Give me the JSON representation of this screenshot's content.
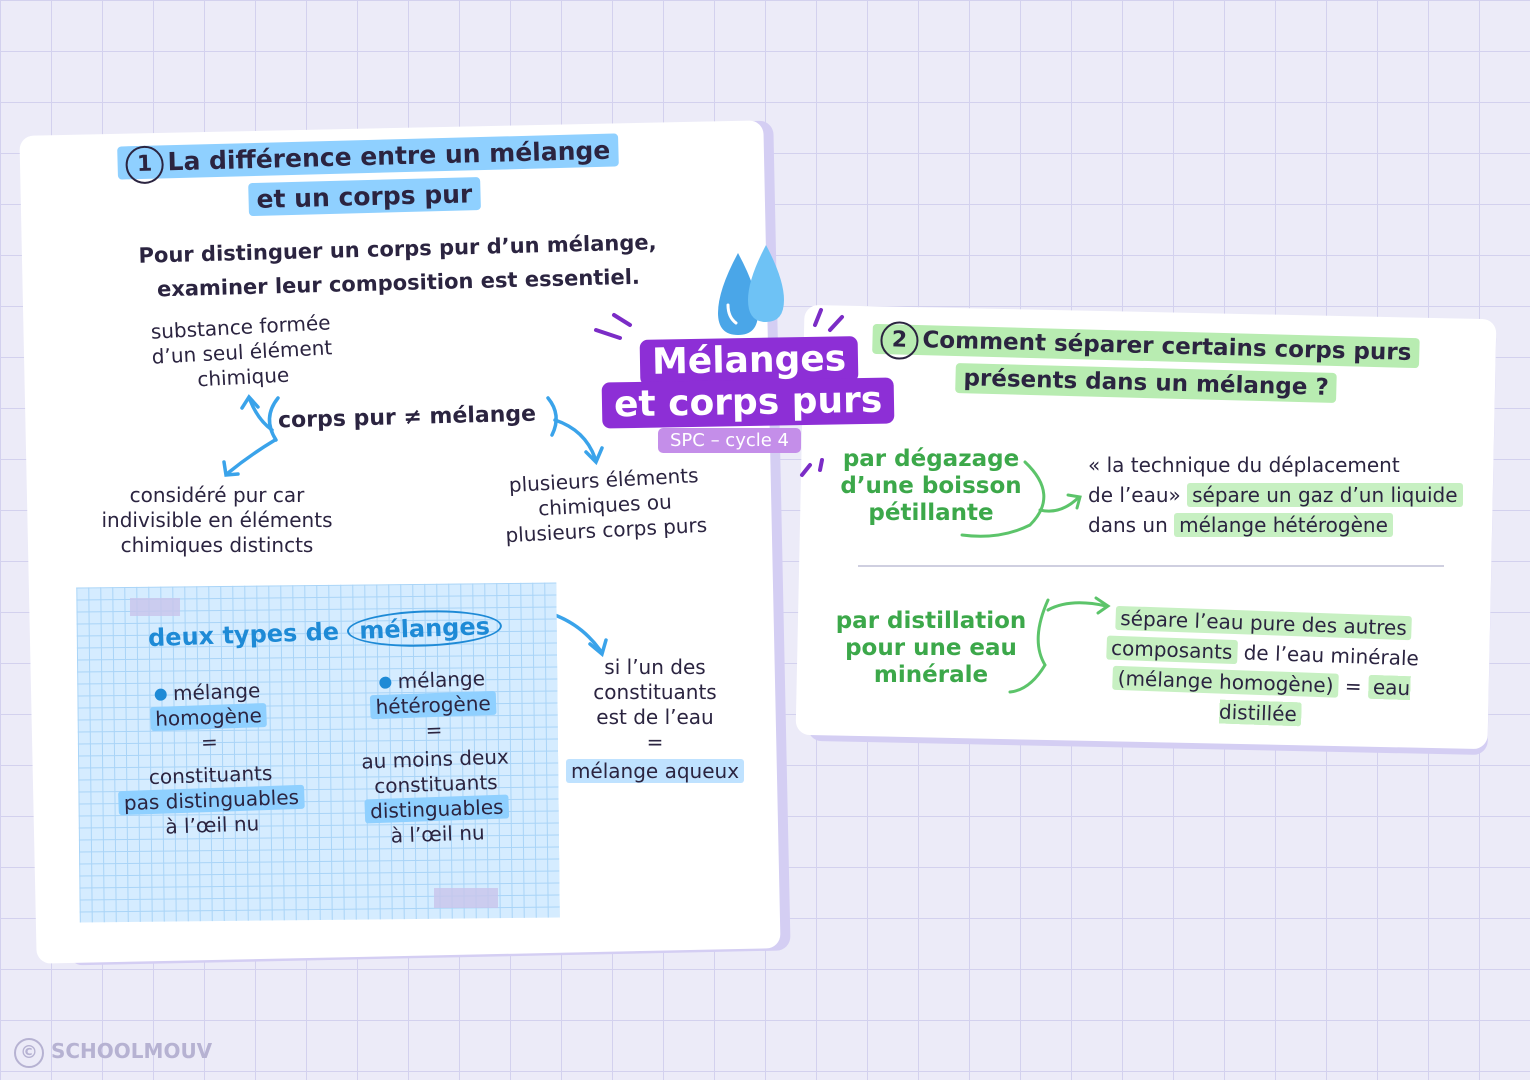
{
  "main_title": {
    "line1": "Mélanges",
    "line2": "et corps purs",
    "subtitle": "SPC – cycle 4"
  },
  "section1": {
    "number": "1",
    "title_line1": "La différence entre un mélange",
    "title_line2": "et un corps pur",
    "intro_line1": "Pour distinguer un corps pur d’un mélange,",
    "intro_line2": "examiner leur composition est essentiel.",
    "center_label": "corps pur ≠ mélange",
    "def_top_line1": "substance formée",
    "def_top_line2": "d’un seul élément",
    "def_top_line3": "chimique",
    "def_left_line1": "considéré pur car",
    "def_left_line2": "indivisible en éléments",
    "def_left_line3": "chimiques distincts",
    "def_right_line1": "plusieurs éléments",
    "def_right_line2": "chimiques ou",
    "def_right_line3": "plusieurs corps purs",
    "types_title_part1": "deux types de",
    "types_title_part2": "mélanges",
    "homogeneous": {
      "word": "mélange",
      "hl": "homogène",
      "equals": "=",
      "line1": "constituants",
      "line2": "pas distinguables",
      "line3": "à l’œil nu"
    },
    "heterogeneous": {
      "word": "mélange",
      "hl": "hétérogène",
      "equals": "=",
      "line1": "au moins deux",
      "line2": "constituants",
      "line3": "distinguables",
      "line4": "à l’œil nu"
    },
    "aqueous": {
      "line1": "si l’un des",
      "line2": "constituants",
      "line3": "est de l’eau",
      "equals": "=",
      "hl": "mélange aqueux"
    }
  },
  "section2": {
    "number": "2",
    "title_line1": "Comment séparer certains corps purs",
    "title_line2": "présents dans un mélange ?",
    "method1": {
      "label_line1": "par dégazage",
      "label_line2": "d’une boisson",
      "label_line3": "pétillante",
      "desc_line1": "« la technique du déplacement",
      "desc_line2a": "de l’eau»",
      "desc_line2b": "sépare un gaz d’un liquide",
      "desc_line3a": "dans un",
      "desc_line3b": "mélange hétérogène"
    },
    "method2": {
      "label_line1": "par distillation",
      "label_line2": "pour une eau",
      "label_line3": "minérale",
      "desc_line1": "sépare l’eau pure des autres",
      "desc_line2a": "composants",
      "desc_line2b": "de l’eau minérale",
      "desc_line3a": "(mélange homogène)",
      "desc_line3b": "=",
      "desc_line3c": "eau distillée"
    }
  },
  "footer": {
    "copyright_symbol": "©",
    "brand": "SCHOOLMOUV"
  },
  "colors": {
    "purple": "#8d2fd6",
    "blue": "#1e8ad6",
    "green": "#3ca84a",
    "light_blue_hl": "#8fd0ff",
    "light_green_hl": "#b8ecb1"
  }
}
